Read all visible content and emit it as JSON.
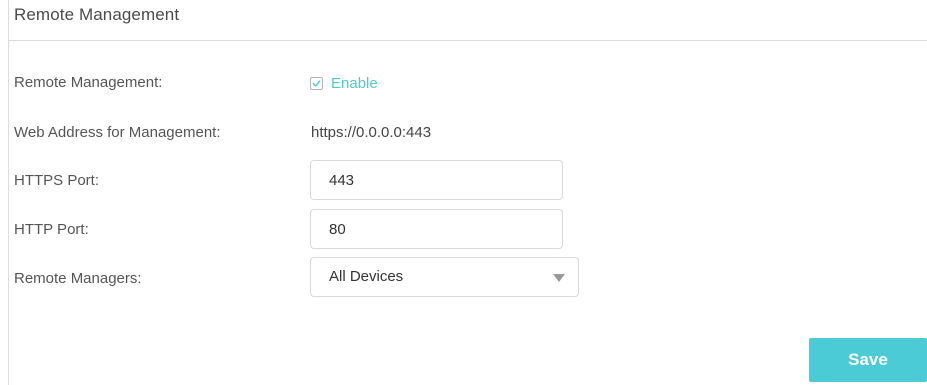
{
  "section": {
    "title": "Remote Management"
  },
  "form": {
    "remote_management": {
      "label": "Remote Management:",
      "checkbox_label": "Enable",
      "checked": true
    },
    "web_address": {
      "label": "Web Address for Management:",
      "value": "https://0.0.0.0:443"
    },
    "https_port": {
      "label": "HTTPS Port:",
      "value": "443"
    },
    "http_port": {
      "label": "HTTP Port:",
      "value": "80"
    },
    "remote_managers": {
      "label": "Remote Managers:",
      "selected": "All Devices"
    }
  },
  "actions": {
    "save_label": "Save"
  },
  "colors": {
    "accent": "#4acbd6",
    "border": "#d9d9d9",
    "text": "#4a4a4a"
  },
  "icons": {
    "checkbox": "checkmark-icon",
    "dropdown": "caret-down-icon"
  }
}
